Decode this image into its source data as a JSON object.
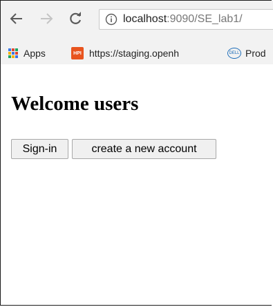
{
  "browser": {
    "url_host": "localhost",
    "url_path": ":9090/SE_lab1/",
    "bookmarks": [
      {
        "label": "Apps",
        "icon": "apps-grid-icon"
      },
      {
        "label": "https://staging.openh",
        "icon": "hpi-favicon"
      },
      {
        "label": "Prod",
        "icon": "dell-favicon"
      }
    ]
  },
  "page": {
    "heading": "Welcome users",
    "buttons": {
      "signin": "Sign-in",
      "create": "create a new account"
    }
  },
  "colors": {
    "chrome_bg": "#f2f2f2",
    "page_bg": "#ffffff",
    "button_bg": "#f0f0f0"
  }
}
